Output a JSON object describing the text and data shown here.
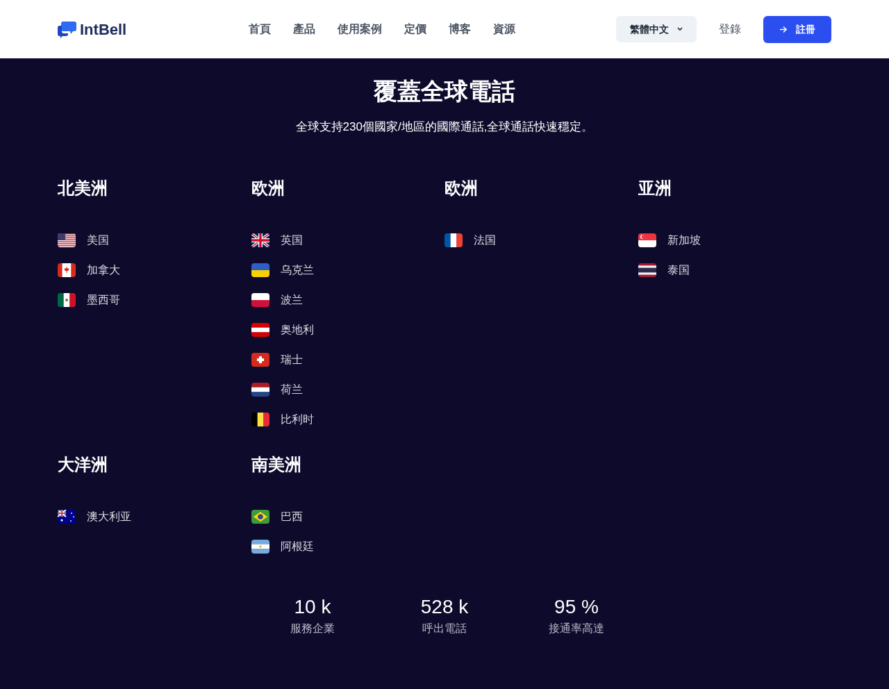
{
  "header": {
    "logo": "IntBell",
    "nav": [
      {
        "label": "首頁"
      },
      {
        "label": "產品"
      },
      {
        "label": "使用案例"
      },
      {
        "label": "定價"
      },
      {
        "label": "博客"
      },
      {
        "label": "資源"
      }
    ],
    "language": "繁體中文",
    "login": "登錄",
    "signup": "註冊"
  },
  "hero": {
    "title": "覆蓋全球電話",
    "subtitle": "全球支持230個國家/地區的國際通話,全球通話快速穩定。"
  },
  "regions": [
    {
      "name": "北美洲",
      "countries": [
        {
          "name": "美国",
          "kind": "us"
        },
        {
          "name": "加拿大",
          "kind": "ca"
        },
        {
          "name": "墨西哥",
          "kind": "mx"
        }
      ]
    },
    {
      "name": "欧洲",
      "countries": [
        {
          "name": "英国",
          "kind": "gb"
        },
        {
          "name": "乌克兰",
          "kind": "ua"
        },
        {
          "name": "波兰",
          "kind": "pl"
        },
        {
          "name": "奥地利",
          "kind": "at"
        },
        {
          "name": "瑞士",
          "kind": "ch"
        },
        {
          "name": "荷兰",
          "kind": "nl"
        },
        {
          "name": "比利时",
          "kind": "be"
        }
      ]
    },
    {
      "name": "欧洲",
      "countries": [
        {
          "name": "法国",
          "kind": "fr"
        }
      ]
    },
    {
      "name": "亚洲",
      "countries": [
        {
          "name": "新加坡",
          "kind": "sg"
        },
        {
          "name": "泰国",
          "kind": "th"
        }
      ]
    },
    {
      "name": "大洋洲",
      "countries": [
        {
          "name": "澳大利亚",
          "kind": "au"
        }
      ]
    },
    {
      "name": "南美洲",
      "countries": [
        {
          "name": "巴西",
          "kind": "br"
        },
        {
          "name": "阿根廷",
          "kind": "ar"
        }
      ]
    }
  ],
  "stats": [
    {
      "value": "10 k",
      "label": "服務企業"
    },
    {
      "value": "528 k",
      "label": "呼出電話"
    },
    {
      "value": "95 %",
      "label": "接通率高達"
    }
  ]
}
